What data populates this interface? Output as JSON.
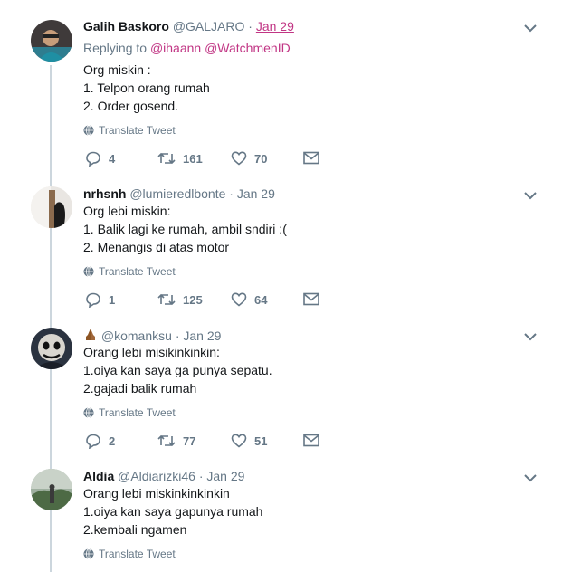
{
  "tweets": [
    {
      "name": "Galih Baskoro",
      "handle": "@GALJARO",
      "time": "Jan 29",
      "replying_label": "Replying to",
      "mentions": [
        "@ihaann",
        "@WatchmenID"
      ],
      "lines": [
        "Org miskin :",
        "1. Telpon orang rumah",
        "2. Order gosend."
      ],
      "translate": "Translate Tweet",
      "replies": "4",
      "retweets": "161",
      "likes": "70"
    },
    {
      "name": "nrhsnh",
      "handle": "@lumieredlbonte",
      "time": "Jan 29",
      "lines": [
        "Org lebi miskin:",
        "1. Balik lagi ke rumah, ambil sndiri :(",
        "2. Menangis di atas motor"
      ],
      "translate": "Translate Tweet",
      "replies": "1",
      "retweets": "125",
      "likes": "64"
    },
    {
      "name": "",
      "handle": "@komanksu",
      "time": "Jan 29",
      "lines": [
        "Orang lebi misikinkinkin:",
        "1.oiya kan saya ga punya sepatu.",
        "2.gajadi balik rumah"
      ],
      "translate": "Translate Tweet",
      "replies": "2",
      "retweets": "77",
      "likes": "51"
    },
    {
      "name": "Aldia",
      "handle": "@Aldiarizki46",
      "time": "Jan 29",
      "lines": [
        "Orang lebi miskinkinkinkin",
        "1.oiya kan saya gapunya rumah",
        "2.kembali ngamen"
      ],
      "translate": "Translate Tweet"
    }
  ],
  "separator": "·",
  "colors": {
    "thread_line": "#ccd6dd",
    "mention": "#c13584",
    "muted": "#657786",
    "text": "#14171a"
  },
  "icons": {
    "caret": "chevron-down-icon",
    "globe": "globe-icon",
    "reply": "reply-icon",
    "retweet": "retweet-icon",
    "like": "heart-icon",
    "dm": "envelope-icon",
    "name_emoji": "praying-hands-icon"
  }
}
